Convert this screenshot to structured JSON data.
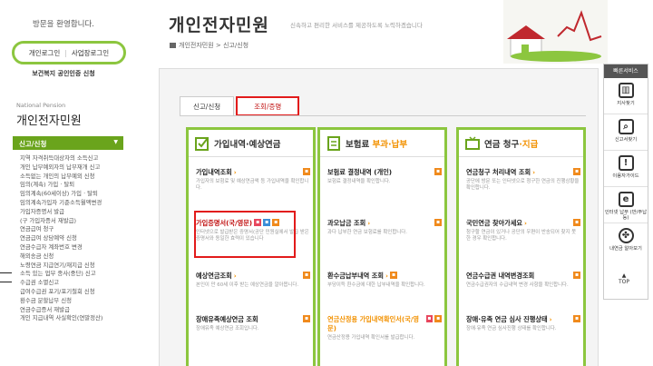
{
  "sidebar": {
    "welcome": "방문을 환영합니다.",
    "login_personal": "개인로그인",
    "login_business": "사업장로그인",
    "cert": "보건복지 공인인증 신청",
    "np_en": "National Pension",
    "np_ko": "개인전자민원",
    "menu_head": "신고/신청",
    "items": [
      "지역 자격취득대상자의 소득신고",
      "개인 납부예외자의 납부재개 신고",
      "소득없는 개인의 납부예외 신청",
      "임의(계속) 가입 · 탈퇴",
      "임의계속(60세이상) 가입 · 탈퇴",
      "임의계속가입자 기준소득월액변경",
      "가입자증명서 발급",
      "(구 가입자증서 재발급)",
      "연금급여 청구",
      "연금급여 상담예약 신청",
      "연금수급자 계좌번호 변경",
      "해외송금 신청",
      "노령연금 지급연기/재지급 신청",
      "소득 있는 업무 종사(중단) 신고",
      "수급권 소멸신고",
      "급여수급권 포기/포기철회 신청",
      "환수금 분할납부 신청",
      "연금수급증서 재발급",
      "개인 지급내역 사실확인(연말정산)"
    ]
  },
  "header": {
    "title": "개인전자민원",
    "tagline": "신속하고 편리한 서비스를 제공하도록 노력하겠습니다",
    "breadcrumb": "개인전자민원 > 신고/신청"
  },
  "tabs": [
    "신고/신청",
    "조회/증명"
  ],
  "columns": [
    {
      "title_a": "가입내역",
      "title_b": "·예상연금",
      "items": [
        {
          "name": "가입내역조회",
          "desc": "가입자의 보험료 및 예상연금액 등 가입내역을 확인합니다."
        },
        {
          "name": "가입증명서(국/영문)",
          "desc": "인터넷으로 발급받은 증명서(공단 민원실에서 발급 받은 증명서와 동일한 효력이 있습니다"
        },
        {
          "name": "예상연금조회",
          "desc": "본인이 만 60세 이후 받는 예상연금을 알아봅니다."
        },
        {
          "name": "장애유족예상연금 조회",
          "desc": "장애유족 예상연금 조회입니다."
        }
      ]
    },
    {
      "title_a": "보험료",
      "title_b": " 부과·납부",
      "items": [
        {
          "name": "보험료 결정내역 (개인)",
          "desc": "보험료 결정내역을 확인합니다."
        },
        {
          "name": "과오납금 조회",
          "desc": "과다 납부한 연금 보험료를 확인합니다."
        },
        {
          "name": "환수금납부내역 조회",
          "desc": "부당이득 환수금에 대한 납부내역을 확인합니다."
        },
        {
          "name": "연금산정용 가입내역확인서(국/영문)",
          "desc": "연금산정용 가입내역 확인서를 발급합니다."
        }
      ]
    },
    {
      "title_a": "연금 청구",
      "title_b": "·지급",
      "items": [
        {
          "name": "연금청구 처리내역 조회",
          "desc": "공단에 방문 또는 인터넷으로 청구한 연금의 진행상황을 확인합니다."
        },
        {
          "name": "국민연금 찾아가세요",
          "desc": "청구할 연금이 있거나 공단의 우편이 반송되어 찾지 못한 경우 확인합니다."
        },
        {
          "name": "연금수급권 내역변경조회",
          "desc": "연금수급권자의 수급내역 변경 사항을 확인합니다."
        },
        {
          "name": "장애·유족 연금 심사 진행상태",
          "desc": "장애·유족 연금 심사진행 상태를 확인합니다."
        }
      ]
    }
  ],
  "quick": {
    "header": "빠른서비스",
    "items": [
      {
        "icon": "building-icon",
        "label": "지사찾기"
      },
      {
        "icon": "magnifier-icon",
        "label": "신고서찾기"
      },
      {
        "icon": "exclamation-icon",
        "label": "이용자가이드"
      },
      {
        "icon": "e-icon",
        "label": "인터넷 납부 (반/주납 등)"
      },
      {
        "icon": "clover-icon",
        "label": "내연금 알아보기"
      }
    ],
    "top": "TOP"
  }
}
